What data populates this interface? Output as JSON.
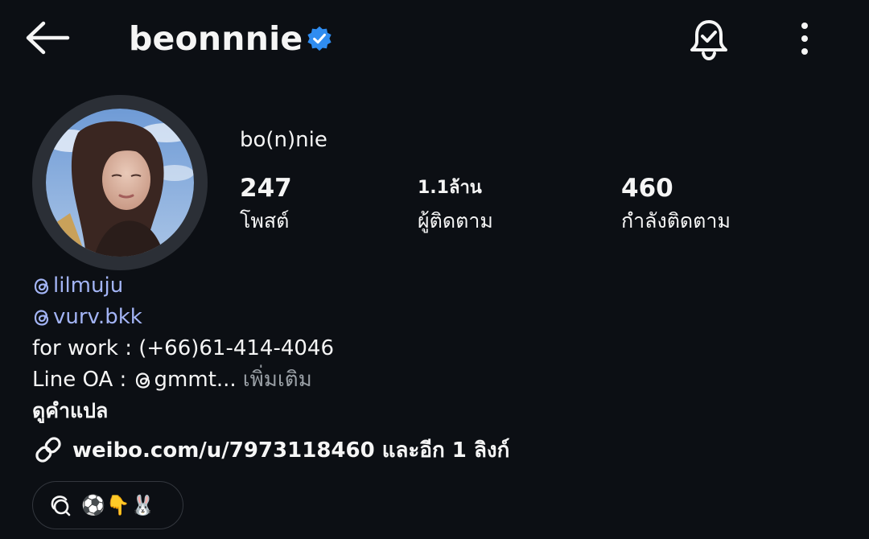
{
  "header": {
    "username": "beonnnie",
    "back_icon": "arrow-left-icon",
    "verified_icon": "verified-badge-icon",
    "bell_icon": "bell-check-icon",
    "more_icon": "more-vertical-icon"
  },
  "profile": {
    "display_name": "bo(n)nie",
    "stats": {
      "posts": {
        "value": "247",
        "label": "โพสต์"
      },
      "followers": {
        "value": "1.1ล้าน",
        "label": "ผู้ติดตาม"
      },
      "following": {
        "value": "460",
        "label": "กำลังติดตาม"
      }
    }
  },
  "bio": {
    "mention_1": "lilmuju",
    "mention_2": "vurv.bkk",
    "line_work": "for work : (+66)61-414-4046",
    "line_oa_prefix": "Line OA : ",
    "line_oa_handle": "gmmt...",
    "see_more": "เพิ่มเติม",
    "translate": "ดูคำแปล"
  },
  "link": {
    "text": "weibo.com/u/7973118460 และอีก 1 ลิงก์",
    "icon": "link-icon"
  },
  "threads_chip": {
    "icon": "threads-icon",
    "emojis": "⚽👇🐰"
  },
  "colors": {
    "background": "#0c0f14",
    "text": "#f5f5f5",
    "mention": "#a3b4f5",
    "verified": "#2f8cf0",
    "muted": "#9aa0a6"
  }
}
